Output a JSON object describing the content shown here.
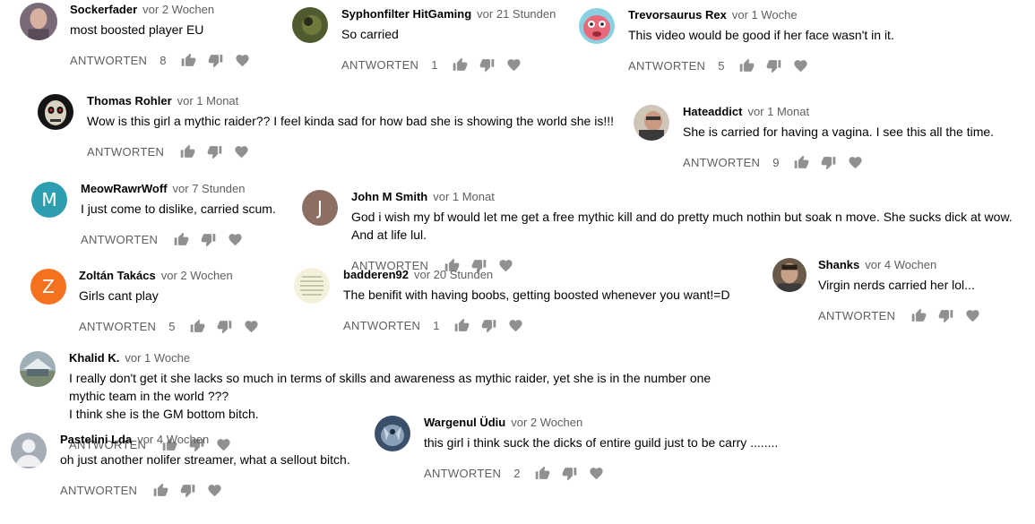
{
  "action_label": "ANTWORTEN",
  "comments": [
    {
      "id": "c1",
      "author": "Sockerfader",
      "time": "vor 2 Wochen",
      "text": [
        "most boosted player EU"
      ],
      "likes": "8"
    },
    {
      "id": "c2",
      "author": "Syphonfilter HitGaming",
      "time": "vor 21 Stunden",
      "text": [
        "So carried"
      ],
      "likes": "1"
    },
    {
      "id": "c3",
      "author": "Trevorsaurus Rex",
      "time": "vor 1 Woche",
      "text": [
        "This video would be good if her face wasn't in it."
      ],
      "likes": "5"
    },
    {
      "id": "c4",
      "author": "Thomas Rohler",
      "time": "vor 1 Monat",
      "text": [
        "Wow is this girl a mythic raider?? I feel kinda sad for how bad she is showing the world she is!!!"
      ],
      "likes": ""
    },
    {
      "id": "c5",
      "author": "Hateaddict",
      "time": "vor 1 Monat",
      "text": [
        "She is  carried for having a vagina. I see this all the time."
      ],
      "likes": "9"
    },
    {
      "id": "c6",
      "author": "MeowRawrWoff",
      "time": "vor 7 Stunden",
      "text": [
        "I just come to dislike, carried scum."
      ],
      "likes": "",
      "avatar_letter": "M",
      "avatar_color": "#2e9fb0"
    },
    {
      "id": "c7",
      "author": "John M Smith",
      "time": "vor 1 Monat",
      "text": [
        "God i wish my bf would let me get a free mythic kill and do pretty much nothin but soak n move. She sucks dick at wow.",
        "And at life lul."
      ],
      "likes": "",
      "avatar_letter": "J",
      "avatar_color": "#8d6e63"
    },
    {
      "id": "c8",
      "author": "Zoltán Takács",
      "time": "vor 2 Wochen",
      "text": [
        "Girls cant play"
      ],
      "likes": "5",
      "avatar_letter": "Z",
      "avatar_color": "#f4711f"
    },
    {
      "id": "c9",
      "author": "badderen92",
      "time": "vor 20 Stunden",
      "text": [
        "The benifit with having boobs, getting boosted whenever you want!=D"
      ],
      "likes": "1"
    },
    {
      "id": "c10",
      "author": "Shanks",
      "time": "vor 4 Wochen",
      "text": [
        "Virgin nerds carried her lol..."
      ],
      "likes": ""
    },
    {
      "id": "c11",
      "author": "Khalid K.",
      "time": "vor 1 Woche",
      "text": [
        "I really don't get it she lacks so much in terms of skills and awareness as mythic raider, yet she is in the number one",
        "mythic team in the world ???",
        "I think she is the GM bottom bitch."
      ],
      "likes": ""
    },
    {
      "id": "c12",
      "author": "Wargenul Üdiu",
      "time": "vor 2 Wochen",
      "text": [
        "this girl i think suck the dicks of entire guild just to be carry ........"
      ],
      "likes": "2"
    },
    {
      "id": "c13",
      "author": "Pastelini Lda",
      "time": "vor 4 Wochen",
      "text": [
        "oh just another nolifer streamer, what a sellout bitch."
      ],
      "likes": ""
    }
  ]
}
